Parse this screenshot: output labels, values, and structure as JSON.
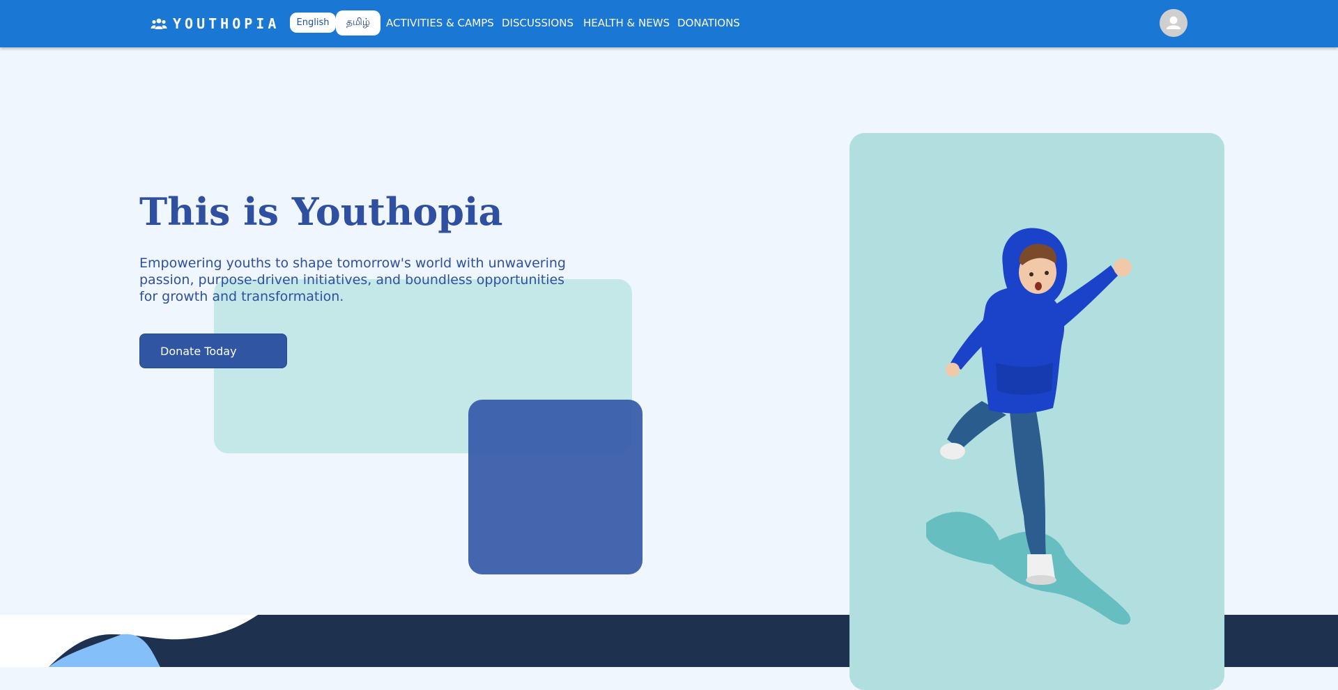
{
  "header": {
    "brand": "YOUTHOPIA",
    "brand_icon": "users-icon",
    "languages": [
      "English",
      "தமிழ்"
    ],
    "nav": [
      "ACTIVITIES & CAMPS",
      "DISCUSSIONS",
      "HEALTH & NEWS",
      "DONATIONS"
    ],
    "avatar_icon": "user-avatar-icon"
  },
  "hero": {
    "title": "This is Youthopia",
    "subtitle": "Empowering youths to shape tomorrow's world with unwavering passion, purpose-driven initiatives, and boundless opportunities for growth and transformation.",
    "cta_label": "Donate Today",
    "image": "boy-superhero-pose-photo"
  },
  "colors": {
    "header_bg": "#1a77d4",
    "page_bg": "#eff6fe",
    "title_blue": "#2f4fa0",
    "button_bg": "#2f55a3",
    "teal_deco": "#c4e7e8",
    "blue_deco": "#3559a8",
    "image_card": "#b1dfdf",
    "footer_band": "#1e314f"
  }
}
